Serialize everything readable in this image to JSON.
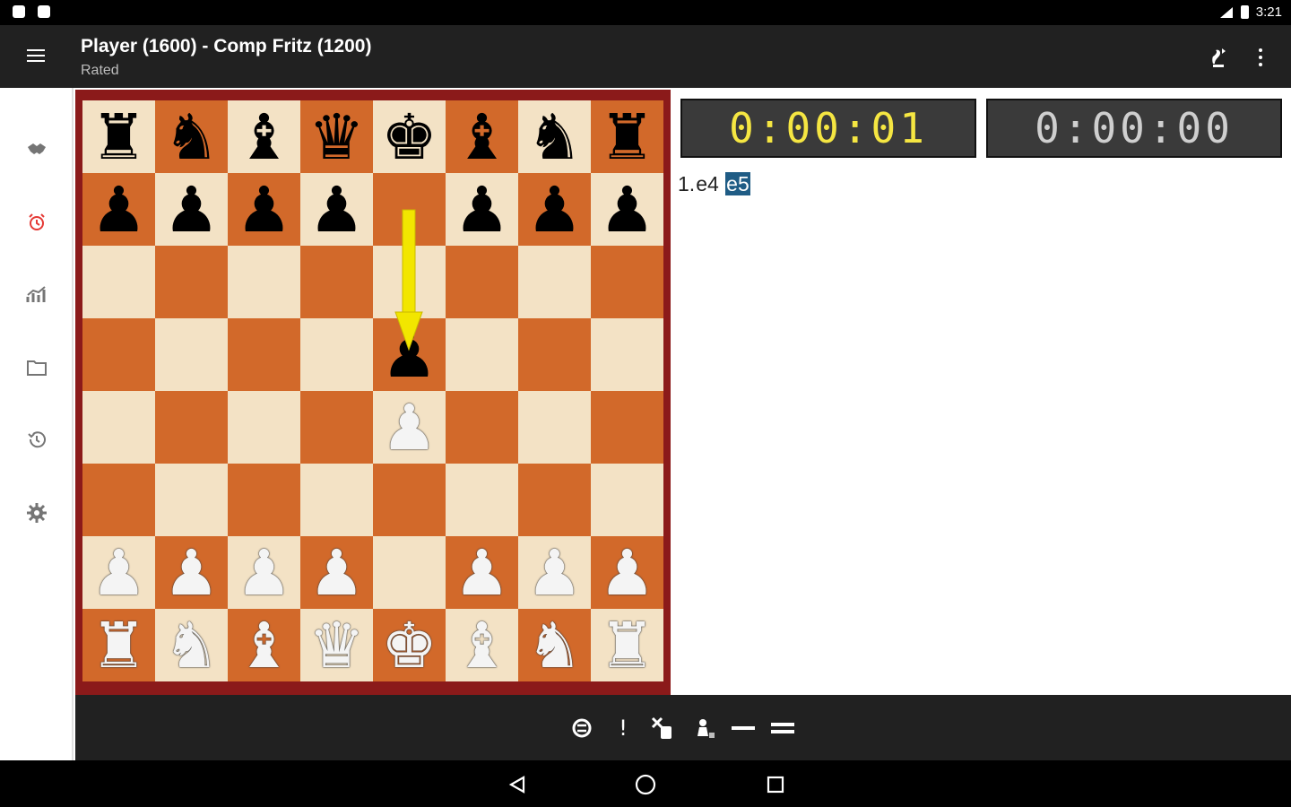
{
  "status_bar": {
    "time": "3:21",
    "icons": [
      "notification-icon",
      "notification-icon",
      "signal-icon",
      "battery-icon"
    ]
  },
  "app_bar": {
    "title": "Player (1600) - Comp Fritz (1200)",
    "subtitle": "Rated",
    "actions": [
      "flip-board-icon",
      "overflow-menu-icon"
    ]
  },
  "sidebar": {
    "items": [
      {
        "icon": "handshake-icon",
        "active": false
      },
      {
        "icon": "alarm-clock-icon",
        "active": true
      },
      {
        "icon": "analysis-graph-icon",
        "active": false
      },
      {
        "icon": "folder-icon",
        "active": false
      },
      {
        "icon": "history-icon",
        "active": false
      },
      {
        "icon": "settings-gear-icon",
        "active": false
      }
    ],
    "active_color": "#e53935"
  },
  "board": {
    "rows": [
      [
        "bR",
        "bN",
        "bB",
        "bQ",
        "bK",
        "bB",
        "bN",
        "bR"
      ],
      [
        "bP",
        "bP",
        "bP",
        "bP",
        "",
        "bP",
        "bP",
        "bP"
      ],
      [
        "",
        "",
        "",
        "",
        "",
        "",
        "",
        ""
      ],
      [
        "",
        "",
        "",
        "",
        "bP",
        "",
        "",
        ""
      ],
      [
        "",
        "",
        "",
        "",
        "wP",
        "",
        "",
        ""
      ],
      [
        "",
        "",
        "",
        "",
        "",
        "",
        "",
        ""
      ],
      [
        "wP",
        "wP",
        "wP",
        "wP",
        "",
        "wP",
        "wP",
        "wP"
      ],
      [
        "wR",
        "wN",
        "wB",
        "wQ",
        "wK",
        "wB",
        "wN",
        "wR"
      ]
    ],
    "last_move": {
      "from": "e7",
      "to": "e5"
    },
    "arrow_color": "#f2e600",
    "light_square": "#f3e2c5",
    "dark_square": "#d2692a",
    "frame_color": "#8b1a1a"
  },
  "clocks": {
    "white": "0:00:01",
    "black": "0:00:00",
    "white_color": "#f5e642",
    "black_color": "#cfcfcf"
  },
  "notation": {
    "move_number": "1.",
    "white_move": "e4",
    "black_move": "e5",
    "highlight_color": "#1f5c85"
  },
  "bottom_toolbar": [
    {
      "icon": "engine-icon",
      "label": ""
    },
    {
      "icon": "annotation-exclam-icon",
      "label": "!"
    },
    {
      "icon": "cut-pieces-icon",
      "label": ""
    },
    {
      "icon": "pawn-promote-icon",
      "label": ""
    },
    {
      "icon": "minus-icon",
      "label": ""
    },
    {
      "icon": "equals-icon",
      "label": ""
    }
  ],
  "nav_bar": [
    "back-icon",
    "home-icon",
    "recents-icon"
  ]
}
